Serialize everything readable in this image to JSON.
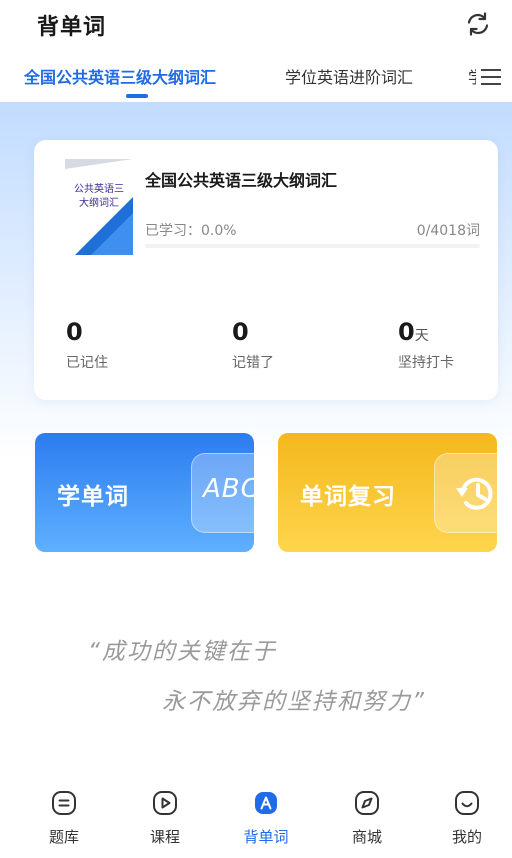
{
  "header": {
    "title": "背单词"
  },
  "tabs": [
    {
      "label": "全国公共英语三级大纲词汇",
      "active": true
    },
    {
      "label": "学位英语进阶词汇",
      "active": false
    },
    {
      "label": "学",
      "active": false
    }
  ],
  "book": {
    "cover_line1": "公共英语三",
    "cover_line2": "大纲词汇",
    "name": "全国公共英语三级大纲词汇",
    "progress_label": "已学习：0.0%",
    "progress_value": 0.0,
    "progress_count": "0/4018词",
    "stats": [
      {
        "value": "0",
        "unit": "",
        "label": "已记住"
      },
      {
        "value": "0",
        "unit": "",
        "label": "记错了"
      },
      {
        "value": "0",
        "unit": "天",
        "label": "坚持打卡"
      }
    ]
  },
  "actions": {
    "learn_label": "学单词",
    "learn_tile_text": "ABC",
    "review_label": "单词复习"
  },
  "quote": {
    "line1": "“成功的关键在于",
    "line2": "永不放弃的坚持和努力”"
  },
  "tabbar": {
    "items": [
      {
        "label": "题库",
        "icon": "question-bank-icon",
        "active": false
      },
      {
        "label": "课程",
        "icon": "play-icon",
        "active": false
      },
      {
        "label": "背单词",
        "icon": "word-a-icon",
        "active": true
      },
      {
        "label": "商城",
        "icon": "compass-icon",
        "active": false
      },
      {
        "label": "我的",
        "icon": "smile-icon",
        "active": false
      }
    ]
  },
  "colors": {
    "accent": "#1f6be8",
    "learn_card": "#2c7cf0",
    "review_card": "#f3b81c"
  }
}
